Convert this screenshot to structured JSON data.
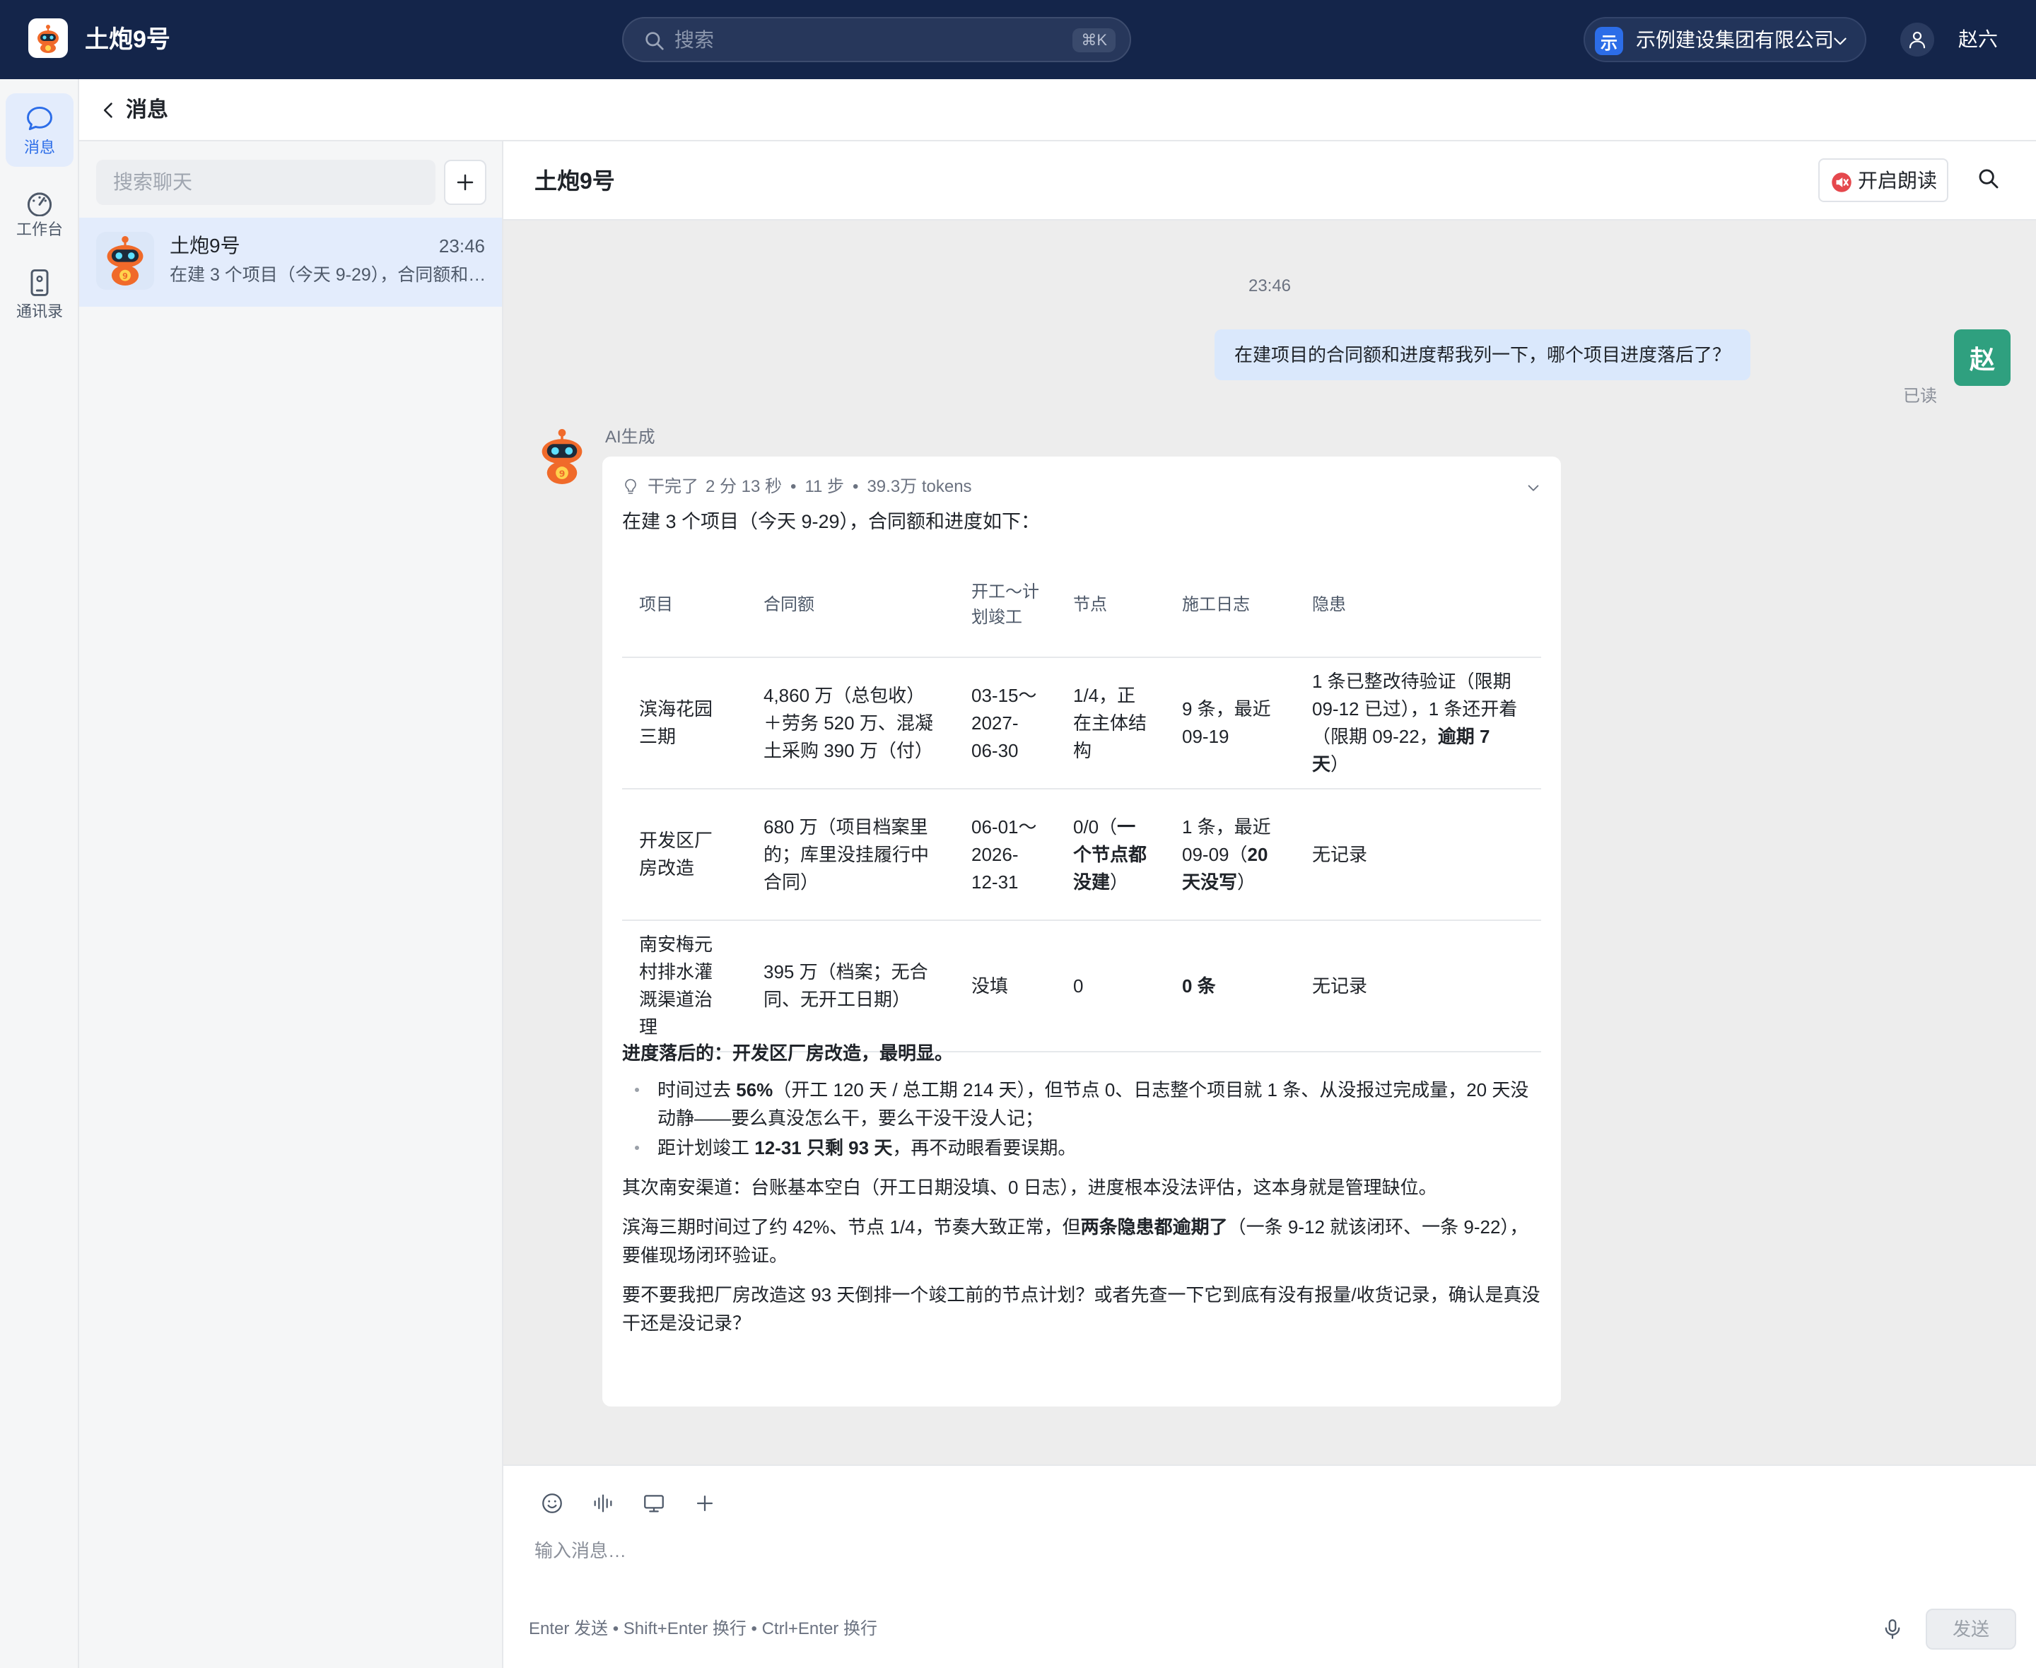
{
  "app": {
    "name": "土炮9号",
    "search_placeholder": "搜索",
    "search_shortcut": "⌘K",
    "org_badge": "示",
    "org_name": "示例建设集团有限公司",
    "user_name": "赵六"
  },
  "rail": {
    "items": [
      {
        "label": "消息",
        "icon": "chat-bubble-icon",
        "active": true
      },
      {
        "label": "工作台",
        "icon": "dashboard-gauge-icon",
        "active": false
      },
      {
        "label": "通讯录",
        "icon": "phone-contacts-icon",
        "active": false
      }
    ]
  },
  "subheader": {
    "title": "消息"
  },
  "chatlist": {
    "search_placeholder": "搜索聊天",
    "items": [
      {
        "name": "土炮9号",
        "time": "23:46",
        "preview": "在建 3 个项目（今天 9-29），合同额和进度如下：项目 合同额 开工～计划竣工 节点 施工日志 隐患"
      }
    ]
  },
  "conversation": {
    "title": "土炮9号",
    "read_aloud_label": "开启朗读",
    "time_divider": "23:46",
    "user_message": "在建项目的合同额和进度帮我列一下，哪个项目进度落后了？",
    "user_avatar_text": "赵",
    "read_status": "已读",
    "ai_label": "AI生成",
    "thinking": {
      "status": "干完了",
      "duration": "2 分 13 秒",
      "steps": "11 步",
      "tokens": "39.3万 tokens",
      "separator": "•"
    },
    "intro": "在建 3 个项目（今天 9-29），合同额和进度如下：",
    "table": {
      "headers": [
        "项目",
        "合同额",
        "开工～计划竣工",
        "节点",
        "施工日志",
        "隐患"
      ],
      "rows": [
        {
          "project": "滨海花园三期",
          "amount": "4,860 万（总包收）＋劳务 520 万、混凝土采购 390 万（付）",
          "schedule": "03-15～2027-06-30",
          "nodes": "1/4，正在主体结构",
          "log": "9 条，最近 09-19",
          "hazard_pre": "1 条已整改待验证（限期 09-12 已过），1 条还开着（限期 09-22，",
          "hazard_bold": "逾期 7 天",
          "hazard_post": "）"
        },
        {
          "project": "开发区厂房改造",
          "amount": "680 万（项目档案里的；库里没挂履行中合同）",
          "schedule": "06-01～2026-12-31",
          "nodes_pre": "0/0（",
          "nodes_bold": "一个节点都没建",
          "nodes_post": "）",
          "log_pre": "1 条，最近 09-09（",
          "log_bold": "20 天没写",
          "log_post": "）",
          "hazard": "无记录"
        },
        {
          "project": "南安梅元村排水灌溉渠道治理",
          "amount": "395 万（档案；无合同、无开工日期）",
          "schedule": "没填",
          "nodes": "0",
          "log_bold": "0 条",
          "hazard": "无记录"
        }
      ]
    },
    "summary": {
      "headline": "进度落后的：开发区厂房改造，最明显。",
      "bullet1_pre": "时间过去 ",
      "bullet1_bold": "56%",
      "bullet1_post": "（开工 120 天 / 总工期 214 天），但节点 0、日志整个项目就 1 条、从没报过完成量，20 天没动静——要么真没怎么干，要么干没干没人记；",
      "bullet2_pre": "距计划竣工 ",
      "bullet2_bold": "12-31 只剩 93 天",
      "bullet2_post": "，再不动眼看要误期。",
      "para2": "其次南安渠道：台账基本空白（开工日期没填、0 日志），进度根本没法评估，这本身就是管理缺位。",
      "para3_pre": "滨海三期时间过了约 42%、节点 1/4，节奏大致正常，但",
      "para3_bold": "两条隐患都逾期了",
      "para3_post": "（一条 9-12 就该闭环、一条 9-22），要催现场闭环验证。",
      "para4": "要不要我把厂房改造这 93 天倒排一个竣工前的节点计划？或者先查一下它到底有没有报量/收货记录，确认是真没干还是没记录？"
    }
  },
  "composer": {
    "placeholder": "输入消息…",
    "hints": "Enter 发送 • Shift+Enter 换行 • Ctrl+Enter 换行",
    "send_label": "发送"
  },
  "colors": {
    "topbar": "#14254a",
    "accent": "#2c6de8",
    "user_avatar": "#2fa07f",
    "user_bubble": "#dae8fc",
    "robot_orange": "#f06a2a"
  }
}
